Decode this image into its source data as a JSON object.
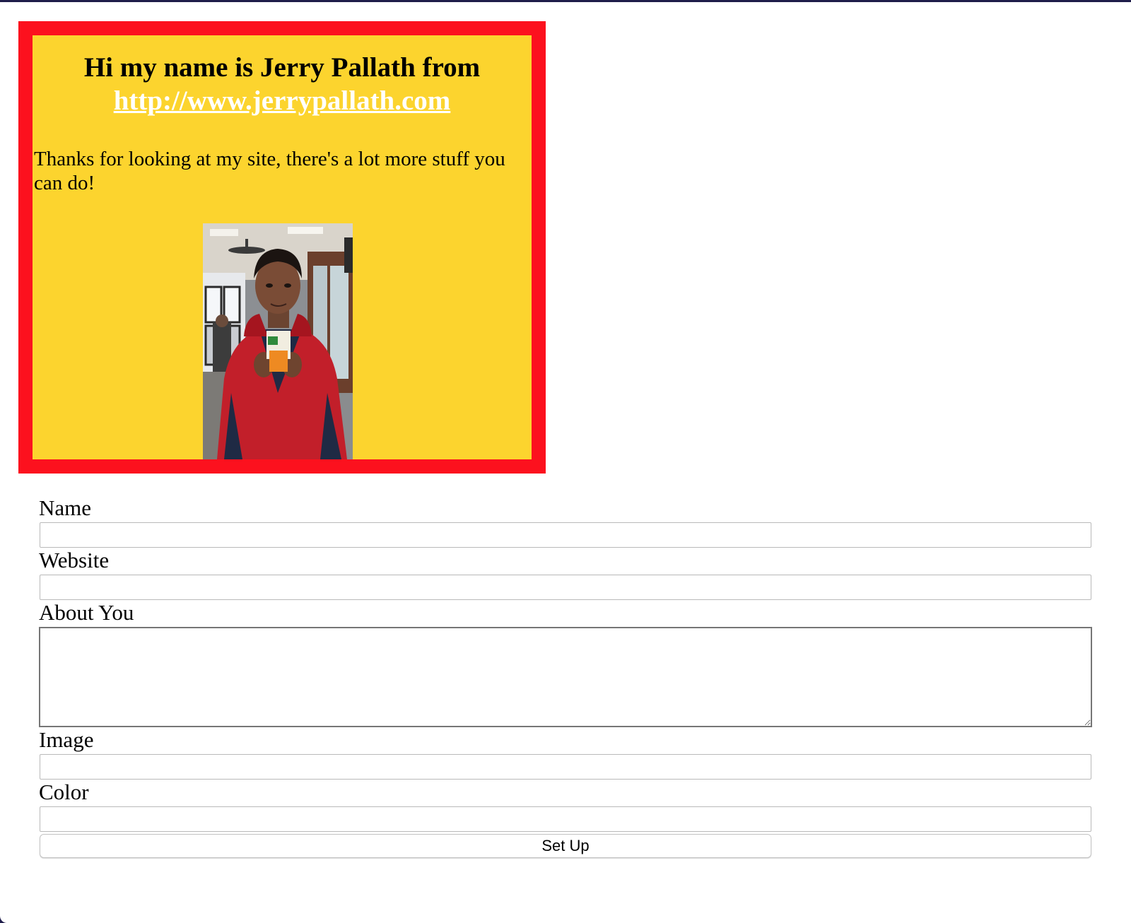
{
  "card": {
    "heading_text": "Hi my name is Jerry Pallath from",
    "heading_link": "http://www.jerrypallath.com",
    "body_text": "Thanks for looking at my site, there's a lot more stuff you can do!",
    "photo_icon": "profile-photo",
    "background_color": "#fcd42e",
    "border_color": "#fc111e",
    "link_color": "#ffffff"
  },
  "form": {
    "name_label": "Name",
    "name_value": "",
    "website_label": "Website",
    "website_value": "",
    "about_label": "About You",
    "about_value": "",
    "image_label": "Image",
    "image_value": "",
    "color_label": "Color",
    "color_value": "",
    "submit_label": "Set Up"
  }
}
